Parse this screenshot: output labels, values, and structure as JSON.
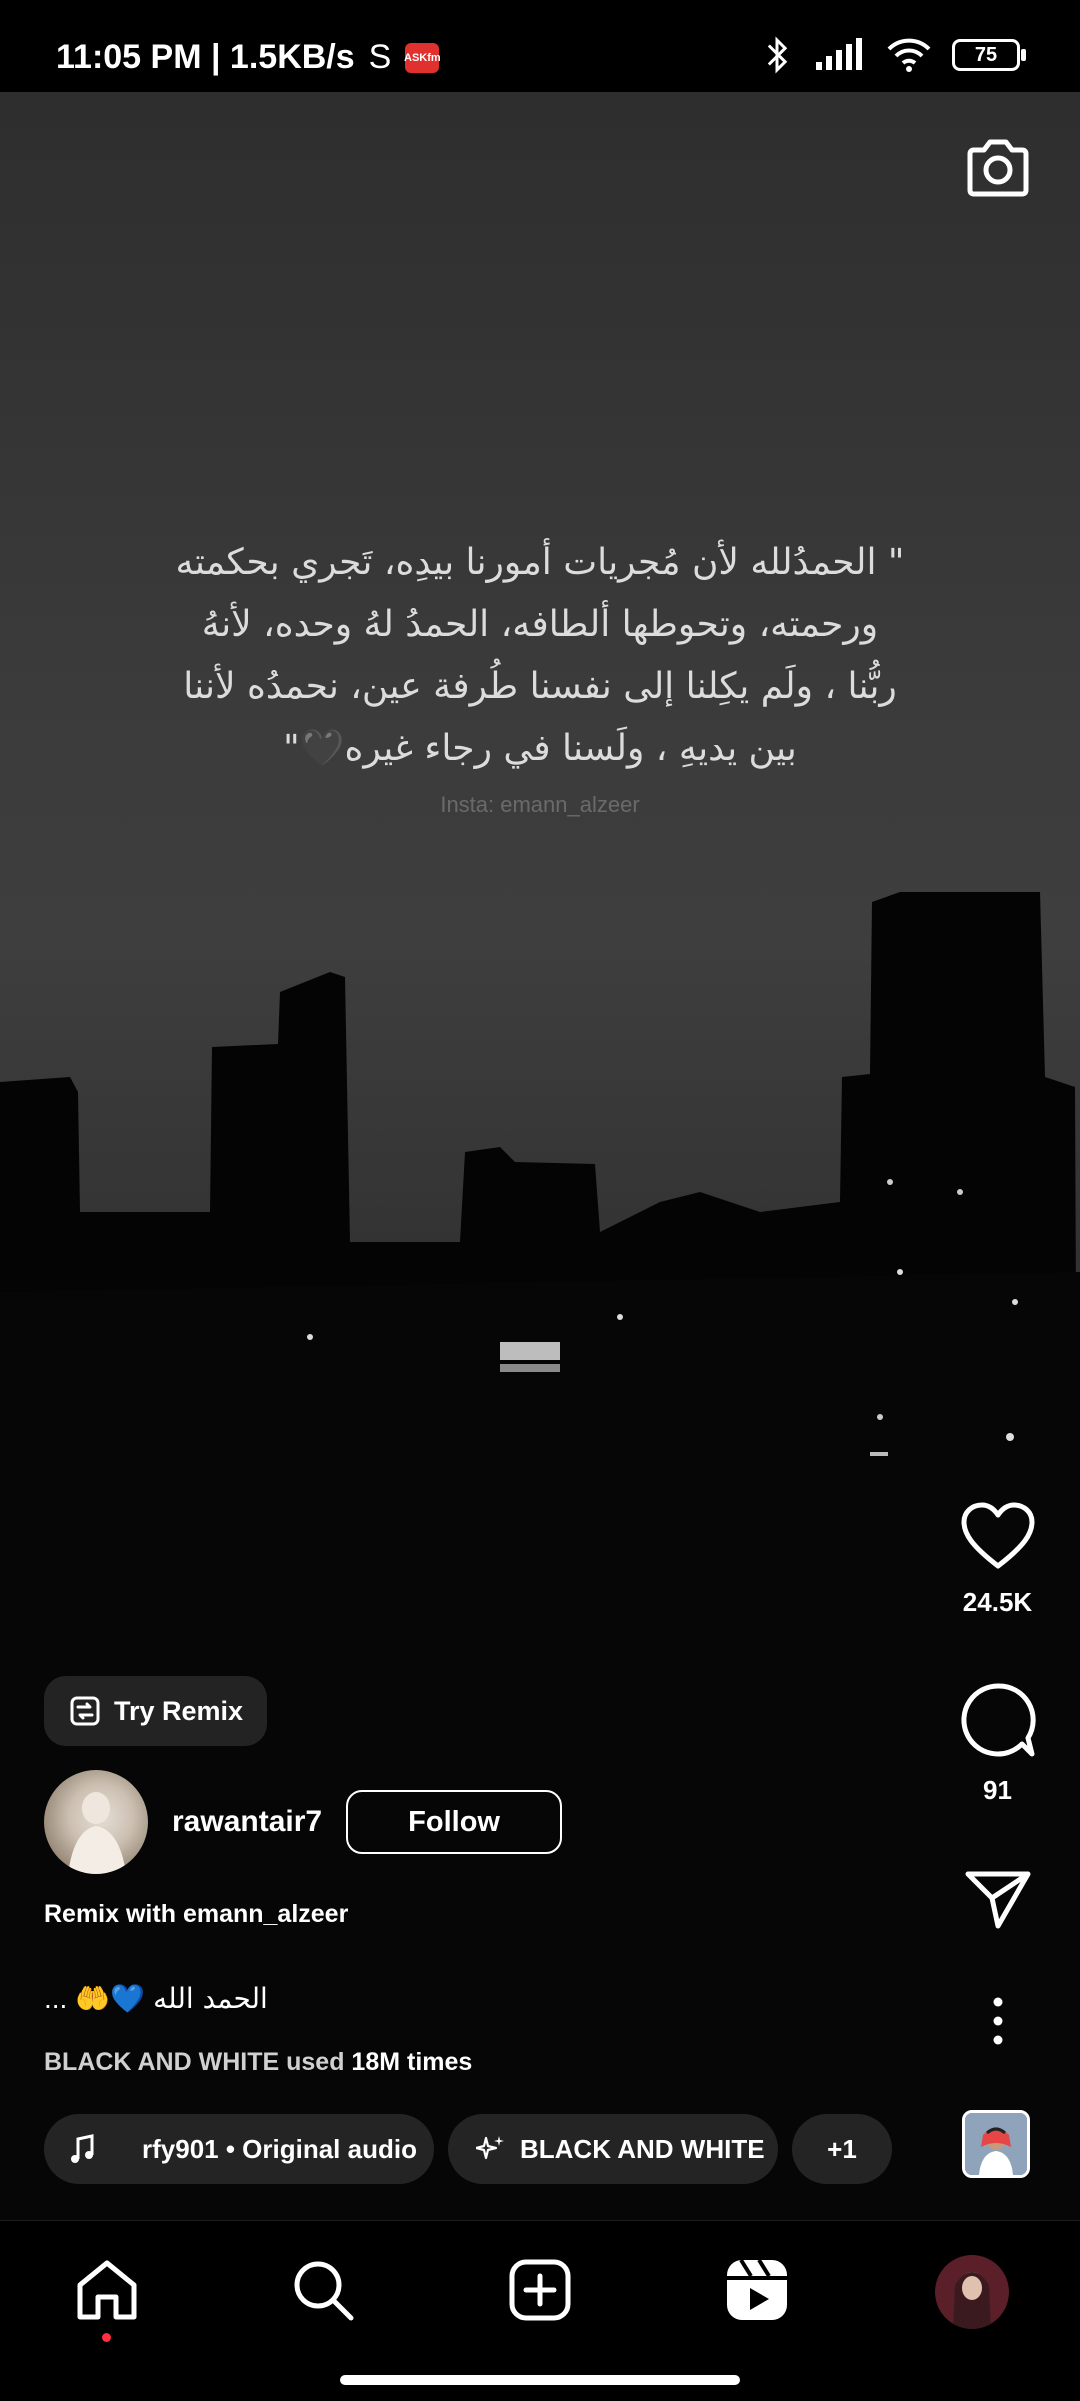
{
  "status_bar": {
    "time_and_speed": "11:05 PM | 1.5KB/s",
    "carrier_glyph": "S",
    "askfm_badge": "ASKfm",
    "battery_level": "75"
  },
  "video": {
    "quote_lines": [
      "\" الحمدُلله لأن مُجريات أمورنا بيدِه، تَجري بحكمته",
      "ورحمته، وتحوطها ألطافه، الحمدُ لهُ وحده، لأنهُ",
      "ربُّنا ، ولَم يكِلنا إلى نفسنا طُرفة عين، نحمدُه لأننا",
      "بين يديهِ ، ولَسنا في رجاء غيره🖤\""
    ],
    "watermark": "Insta: emann_alzeer"
  },
  "actions": {
    "like_count": "24.5K",
    "comment_count": "91"
  },
  "remix_button": {
    "label": "Try Remix"
  },
  "author": {
    "username": "rawantair7",
    "follow_label": "Follow"
  },
  "remix_with": {
    "prefix": "Remix with",
    "user": "emann_alzeer"
  },
  "caption": {
    "text": "الحمد الله",
    "emoji": "🤲💙",
    "more": "..."
  },
  "effect_usage": {
    "name": "BLACK AND WHITE",
    "used": "used",
    "count": "18M times"
  },
  "pills": {
    "audio": "rfy901 • Original audio",
    "effect": "BLACK AND WHITE",
    "more": "+1"
  },
  "nav": {
    "items": [
      "home-icon",
      "search-icon",
      "create-icon",
      "reels-icon",
      "profile-avatar"
    ]
  },
  "colors": {
    "notification_dot": "#ff3040",
    "pill_background": "#262626"
  }
}
